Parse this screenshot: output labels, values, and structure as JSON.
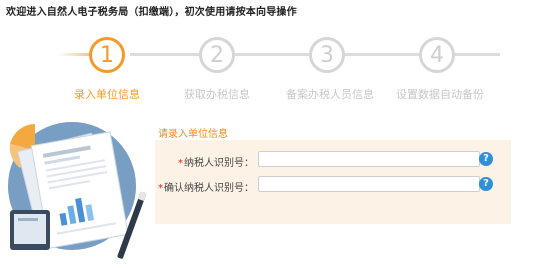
{
  "header": {
    "welcome_text": "欢迎进入自然人电子税务局（扣缴端），初次使用请按本向导操作"
  },
  "wizard": {
    "steps": [
      {
        "number": "1",
        "label": "录入单位信息",
        "active": true
      },
      {
        "number": "2",
        "label": "获取办税信息",
        "active": false
      },
      {
        "number": "3",
        "label": "备案办税人员信息",
        "active": false
      },
      {
        "number": "4",
        "label": "设置数据自动备份",
        "active": false
      }
    ],
    "active_color": "#f39a2b",
    "inactive_color": "#d6d6d6"
  },
  "form": {
    "title": "请录入单位信息",
    "fields": [
      {
        "required_mark": "*",
        "label": "纳税人识别号：",
        "value": "",
        "help": "?"
      },
      {
        "required_mark": "*",
        "label": "确认纳税人识别号：",
        "value": "",
        "help": "?"
      }
    ],
    "panel_color": "#fdf2e6"
  },
  "colors": {
    "accent": "#f39a2b",
    "title_orange": "#f28a1f",
    "help_blue": "#2f8fd8",
    "required_red": "#e2231a"
  }
}
